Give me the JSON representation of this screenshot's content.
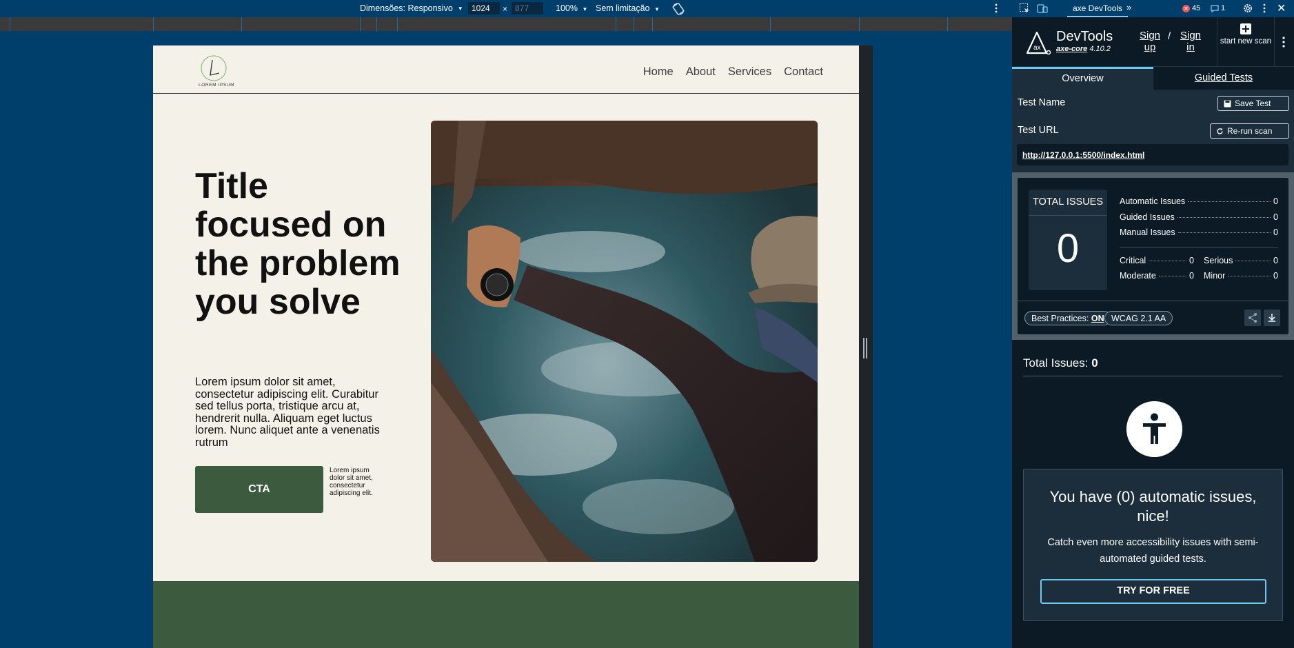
{
  "device_toolbar": {
    "dimensions_label": "Dimensões: Responsivo",
    "width_value": "1024",
    "times": "×",
    "height_value": "877",
    "zoom": "100%",
    "throttle": "Sem limitação"
  },
  "site": {
    "logo_text": "LOREM IPSUM",
    "nav": [
      "Home",
      "About",
      "Services",
      "Contact"
    ],
    "hero_title": "Title focused on the problem you solve",
    "hero_text": "Lorem ipsum dolor sit amet, consectetur adipiscing elit. Curabitur sed tellus porta, tristique arcu at, hendrerit nulla. Aliquam eget luctus lorem. Nunc aliquet ante a venenatis rutrum",
    "cta_label": "CTA",
    "cta_note": "Lorem ipsum dolor sit amet, consectetur adipiscing elit.",
    "colors": {
      "background": "#f4f1e8",
      "green": "#3b5a3e"
    }
  },
  "devtools_tabs": {
    "active_tab": "axe DevTools",
    "more": "»",
    "error_count": "45",
    "message_count": "1"
  },
  "axe": {
    "name": "DevTools",
    "core_label": "axe-core",
    "core_version": "4.10.2",
    "sign_up": "Sign up",
    "slash": "/",
    "sign_in": "Sign in",
    "new_scan": "start new scan",
    "tabs": {
      "overview": "Overview",
      "guided": "Guided Tests"
    },
    "test_name_label": "Test Name",
    "save_test": "Save Test",
    "test_url_label": "Test URL",
    "rerun": "Re-run scan",
    "url": "http://127.0.0.1:5500/index.html",
    "total_caption": "TOTAL ISSUES",
    "total_value": "0",
    "automatic_label": "Automatic Issues",
    "automatic_value": "0",
    "guided_label": "Guided Issues",
    "guided_value": "0",
    "manual_label": "Manual Issues",
    "manual_value": "0",
    "critical_label": "Critical",
    "critical_value": "0",
    "serious_label": "Serious",
    "serious_value": "0",
    "moderate_label": "Moderate",
    "moderate_value": "0",
    "minor_label": "Minor",
    "minor_value": "0",
    "best_practices_label": "Best Practices:",
    "best_practices_value": "ON",
    "wcag": "WCAG 2.1 AA",
    "issues_line_label": "Total Issues:",
    "issues_line_value": "0",
    "nice_heading": "You have (0) automatic issues, nice!",
    "nice_text": "Catch even more accessibility issues with semi-automated guided tests.",
    "try_free": "TRY FOR FREE",
    "colors": {
      "panel": "#0b1a25",
      "card": "#1c2e3c",
      "accent": "#6fc7ee"
    }
  }
}
